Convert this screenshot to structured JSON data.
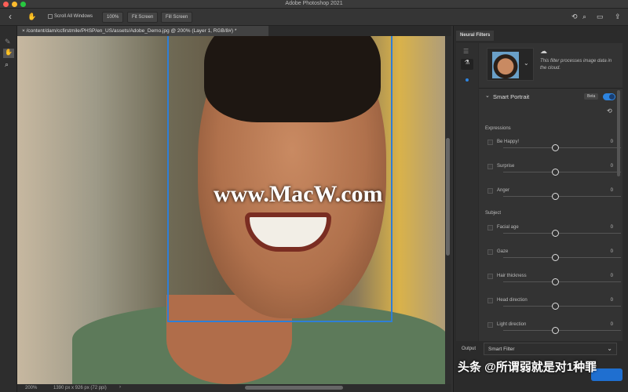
{
  "window": {
    "title": "Adobe Photoshop 2021"
  },
  "options": {
    "scroll_all": "Scroll All Windows",
    "zoom100": "100%",
    "fit": "Fit Screen",
    "fill": "Fill Screen"
  },
  "document": {
    "tab": "/content/dam/ccfirstmile/PHSP/en_US/assets/Adobe_Demo.jpg @ 200% (Layer 1, RGB/8#) *"
  },
  "status": {
    "zoom": "200%",
    "size": "1390 px x 926 px (72 ppi)",
    "arrow": "›"
  },
  "watermarks": {
    "macw": "www.MacW.com",
    "toutiao": "头条 @所谓弱就是对1种罪"
  },
  "panel": {
    "tab": "Neural Filters",
    "cloud_note": "This filter processes image data in the cloud.",
    "filter": "Smart Portrait",
    "badge": "Beta",
    "enabled": true,
    "expressions_label": "Expressions",
    "expressions": [
      {
        "label": "Be Happy!",
        "value": "0"
      },
      {
        "label": "Surprise",
        "value": "0"
      },
      {
        "label": "Anger",
        "value": "0"
      }
    ],
    "subject_label": "Subject",
    "subject": [
      {
        "label": "Facial age",
        "value": "0"
      },
      {
        "label": "Gaze",
        "value": "0"
      },
      {
        "label": "Hair thickness",
        "value": "0"
      },
      {
        "label": "Head direction",
        "value": "0"
      },
      {
        "label": "Light direction",
        "value": "0"
      }
    ],
    "output_label": "Output",
    "output_value": "Smart Filter"
  },
  "colors": {
    "accent": "#2d84e0",
    "facebox": "#2f7fd6"
  }
}
